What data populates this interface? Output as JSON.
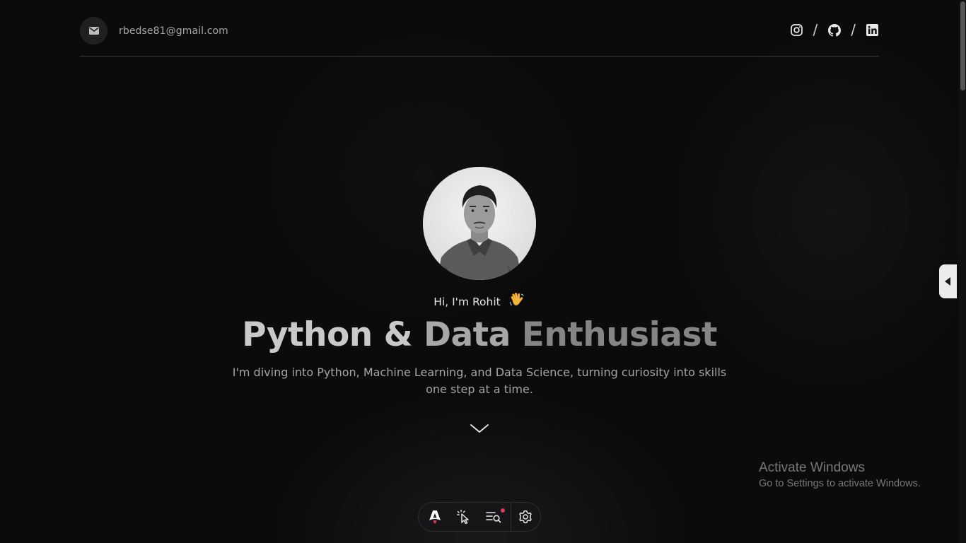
{
  "header": {
    "email": "rbedse81@gmail.com",
    "icons": [
      "mail-icon",
      "instagram-icon",
      "github-icon",
      "linkedin-icon"
    ],
    "separator": "/"
  },
  "hero": {
    "greeting": "Hi, I'm Rohit",
    "greeting_emoji": "waving-hand-icon",
    "title_part1": "Python & ",
    "title_part2": "Data ",
    "title_part3": "Enthusiast",
    "description": "I'm diving into Python, Machine Learning, and Data Science, turning curiosity into skills one step at a time."
  },
  "watermark": {
    "title": "Activate Windows",
    "subtitle": "Go to Settings to activate Windows."
  },
  "toolbar": {
    "icons": [
      "astro-logo-icon",
      "inspect-cursor-icon",
      "audit-icon",
      "settings-icon"
    ]
  },
  "colors": {
    "background": "#0b0b0c",
    "accent_dot": "#e2365b"
  }
}
